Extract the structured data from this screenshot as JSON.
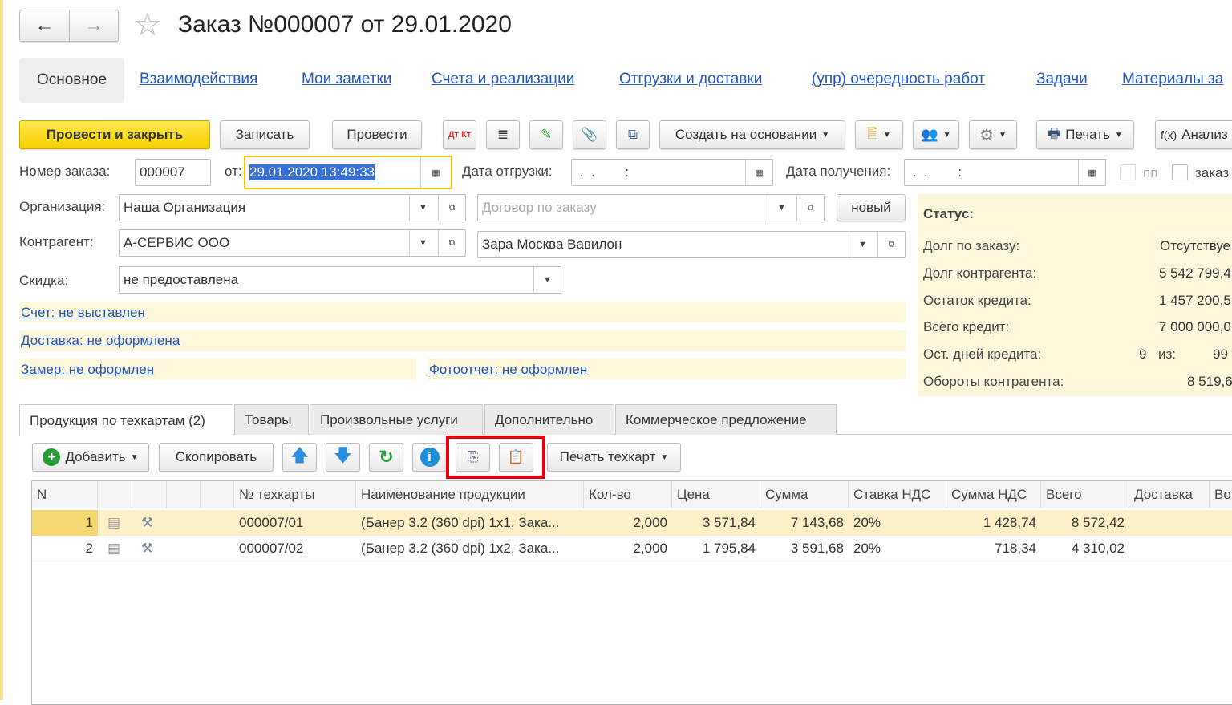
{
  "window": {
    "title": "Заказ №000007 от 29.01.2020"
  },
  "nav": {
    "back": "←",
    "forward": "→",
    "star": "☆"
  },
  "sections": [
    {
      "label": "Основное",
      "active": true
    },
    {
      "label": "Взаимодействия"
    },
    {
      "label": "Мои заметки"
    },
    {
      "label": "Счета и реализации"
    },
    {
      "label": "Отгрузки и доставки"
    },
    {
      "label": "(упр) очередность работ"
    },
    {
      "label": "Задачи"
    },
    {
      "label": "Материалы за"
    }
  ],
  "toolbar": {
    "post_close": "Провести и закрыть",
    "save": "Записать",
    "post": "Провести",
    "dtkt": "Дт Кт",
    "create_based": "Создать на основании",
    "print": "Печать",
    "analysis": "Анализ"
  },
  "form": {
    "order_no_label": "Номер заказа:",
    "order_no": "000007",
    "from_label": "от:",
    "from_value": "29.01.2020 13:49:33",
    "ship_label": "Дата отгрузки:",
    "ship_value": " .  .        :",
    "recv_label": "Дата получения:",
    "recv_value": " .  .        :",
    "pp_label": "пп",
    "order_cb_label": "заказ",
    "org_label": "Организация:",
    "org": "Наша Организация",
    "contract_placeholder": "Договор по заказу",
    "new_button": "новый",
    "counterparty_label": "Контрагент:",
    "counterparty": "А-СЕРВИС ООО",
    "contact": "Зара Москва Вавилон",
    "discount_label": "Скидка:",
    "discount": "не предоставлена"
  },
  "status_links": {
    "invoice": "Счет: не выставлен",
    "delivery": "Доставка: не оформлена",
    "measure": "Замер: не оформлен",
    "photo": "Фотоотчет: не оформлен"
  },
  "status": {
    "title": "Статус:",
    "rows": [
      {
        "label": "Долг по заказу:",
        "value": "Отсутствуе"
      },
      {
        "label": "Долг контрагента:",
        "value": "5 542 799,4"
      },
      {
        "label": "Остаток кредита:",
        "value": "1 457 200,5"
      },
      {
        "label": "Всего кредит:",
        "value": "7 000 000,0"
      },
      {
        "label": "Ост. дней кредита:",
        "value": "99",
        "days": "9",
        "of": "из:"
      },
      {
        "label": "Обороты контрагента:",
        "value": "8 519,6"
      }
    ]
  },
  "tabs": [
    "Продукция по техкартам (2)",
    "Товары",
    "Произвольные услуги",
    "Дополнительно",
    "Коммерческое предложение"
  ],
  "table_toolbar": {
    "add": "Добавить",
    "copy": "Скопировать",
    "print_tk": "Печать техкарт"
  },
  "highlight_color": "#e8000b",
  "table": {
    "headers": [
      "N",
      "",
      "",
      "",
      "",
      "№ техкарты",
      "Наименование продукции",
      "Кол-во",
      "Цена",
      "Сумма",
      "Ставка НДС",
      "Сумма НДС",
      "Всего",
      "Доставка",
      "Во"
    ],
    "rows": [
      {
        "n": "1",
        "tk": "000007/01",
        "name": "(Банер 3.2 (360 dpi)  1x1, Зака...",
        "qty": "2,000",
        "price": "3 571,84",
        "sum": "7 143,68",
        "vat_rate": "20%",
        "vat": "1 428,74",
        "total": "8 572,42"
      },
      {
        "n": "2",
        "tk": "000007/02",
        "name": "(Банер 3.2 (360 dpi)  1x2, Зака...",
        "qty": "2,000",
        "price": "1 795,84",
        "sum": "3 591,68",
        "vat_rate": "20%",
        "vat": "718,34",
        "total": "4 310,02"
      }
    ]
  }
}
